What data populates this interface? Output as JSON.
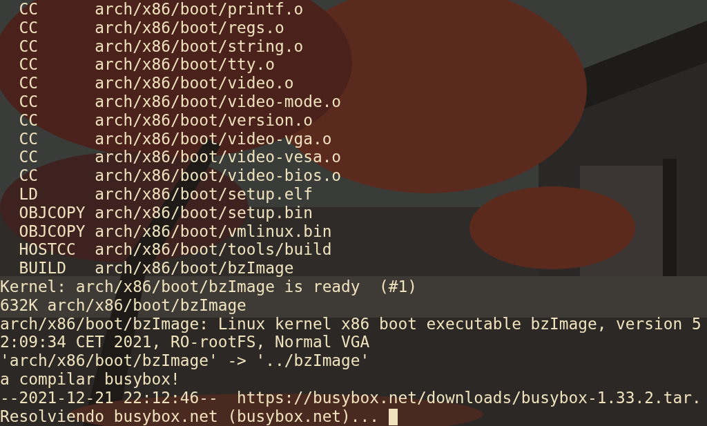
{
  "terminal": {
    "lines": [
      "  CC      arch/x86/boot/printf.o",
      "  CC      arch/x86/boot/regs.o",
      "  CC      arch/x86/boot/string.o",
      "  CC      arch/x86/boot/tty.o",
      "  CC      arch/x86/boot/video.o",
      "  CC      arch/x86/boot/video-mode.o",
      "  CC      arch/x86/boot/version.o",
      "  CC      arch/x86/boot/video-vga.o",
      "  CC      arch/x86/boot/video-vesa.o",
      "  CC      arch/x86/boot/video-bios.o",
      "  LD      arch/x86/boot/setup.elf",
      "  OBJCOPY arch/x86/boot/setup.bin",
      "  OBJCOPY arch/x86/boot/vmlinux.bin",
      "  HOSTCC  arch/x86/boot/tools/build",
      "  BUILD   arch/x86/boot/bzImage",
      "Kernel: arch/x86/boot/bzImage is ready  (#1)",
      "632K arch/x86/boot/bzImage",
      "arch/x86/boot/bzImage: Linux kernel x86 boot executable bzImage, version 5",
      "2:09:34 CET 2021, RO-rootFS, Normal VGA",
      "'arch/x86/boot/bzImage' -> '../bzImage'",
      "a compilar busybox!",
      "--2021-12-21 22:12:46--  https://busybox.net/downloads/busybox-1.33.2.tar.",
      "Resolviendo busybox.net (busybox.net)... "
    ]
  }
}
